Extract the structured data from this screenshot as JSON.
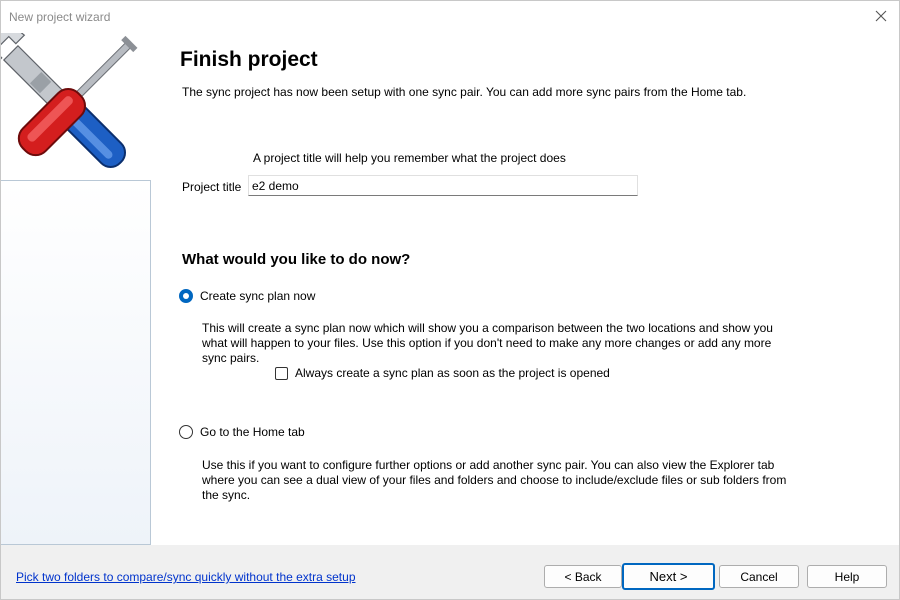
{
  "window": {
    "title": "New project wizard"
  },
  "page": {
    "heading": "Finish project",
    "subtext": "The sync project has now been setup with one sync pair.  You can add more sync pairs from the Home tab."
  },
  "project_title": {
    "hint": "A project title will help you remember what the project does",
    "label": "Project title",
    "value": "e2 demo"
  },
  "question": "What would you like to do now?",
  "options": {
    "create_plan": {
      "label": "Create sync plan now",
      "selected": true,
      "description": "This will create a sync plan now which will show you a comparison between the two locations and show you what will happen to your files.  Use this option if you don't need to make any more changes or add any more sync pairs.",
      "checkbox_label": "Always create a sync plan as soon as the project is opened",
      "checkbox_checked": false
    },
    "home_tab": {
      "label": "Go to the Home tab",
      "selected": false,
      "description": "Use this if you want to configure further options or add another sync pair.  You can also view the Explorer tab where you can see a dual view of your files and folders and choose to include/exclude files or sub folders from the sync."
    }
  },
  "footer": {
    "link": "Pick two folders to compare/sync quickly without the extra setup",
    "back_label": "< Back",
    "next_label": "Next >",
    "cancel_label": "Cancel",
    "help_label": "Help"
  },
  "colors": {
    "accent": "#0067c0",
    "link": "#0033cc",
    "footer_bg": "#f0f0f0"
  },
  "icons": {
    "logo": "wrench-screwdriver-icon",
    "close": "close-icon"
  }
}
